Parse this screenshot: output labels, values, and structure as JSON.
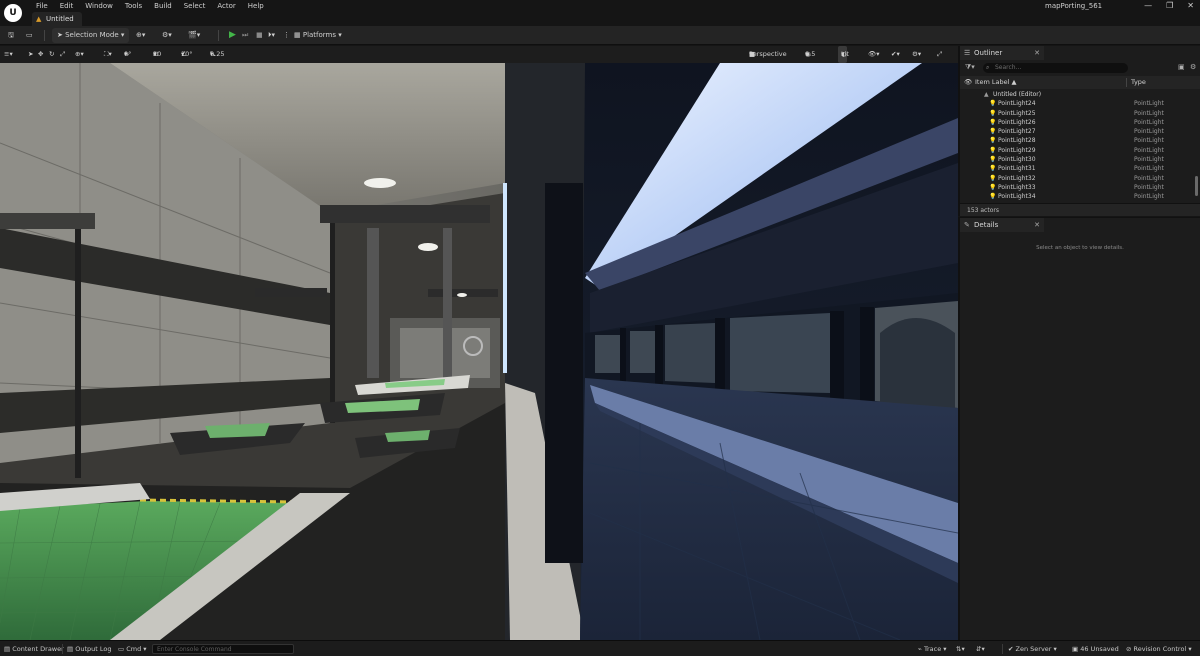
{
  "app": {
    "logo_text": "U",
    "menus": [
      "File",
      "Edit",
      "Window",
      "Tools",
      "Build",
      "Select",
      "Actor",
      "Help"
    ],
    "doc_tab": "Untitled",
    "project_name": "mapPorting_561",
    "window_controls": [
      "—",
      "❐",
      "✕"
    ]
  },
  "toolbar": {
    "selection_mode": "Selection Mode",
    "platforms": "Platforms"
  },
  "viewport": {
    "grid_rotation": "0°",
    "grid_snap": "10",
    "rotation_snap": "10°",
    "scale_snap": "0.25",
    "view_mode_camera": "Perspective",
    "camera_speed": "0.5",
    "lighting": "Lit"
  },
  "outliner": {
    "tab_label": "Outliner",
    "search_placeholder": "Search...",
    "col_label": "Item Label ▲",
    "col_type": "Type",
    "root_item": "Untitled (Editor)",
    "items": [
      {
        "name": "PointLight24",
        "type": "PointLight"
      },
      {
        "name": "PointLight25",
        "type": "PointLight"
      },
      {
        "name": "PointLight26",
        "type": "PointLight"
      },
      {
        "name": "PointLight27",
        "type": "PointLight"
      },
      {
        "name": "PointLight28",
        "type": "PointLight"
      },
      {
        "name": "PointLight29",
        "type": "PointLight"
      },
      {
        "name": "PointLight30",
        "type": "PointLight"
      },
      {
        "name": "PointLight31",
        "type": "PointLight"
      },
      {
        "name": "PointLight32",
        "type": "PointLight"
      },
      {
        "name": "PointLight33",
        "type": "PointLight"
      },
      {
        "name": "PointLight34",
        "type": "PointLight"
      }
    ],
    "actor_count": "153 actors"
  },
  "details": {
    "tab_label": "Details",
    "hint": "Select an object to view details."
  },
  "statusbar": {
    "content_drawer": "Content Drawer",
    "output_log": "Output Log",
    "cmd": "Cmd",
    "console_placeholder": "Enter Console Command",
    "trace": "Trace",
    "zen_server": "Zen Server",
    "unsaved": "46 Unsaved",
    "revision_control": "Revision Control"
  },
  "colors": {
    "accent_play": "#43b649",
    "unsaved_star": "#d79a2a"
  }
}
